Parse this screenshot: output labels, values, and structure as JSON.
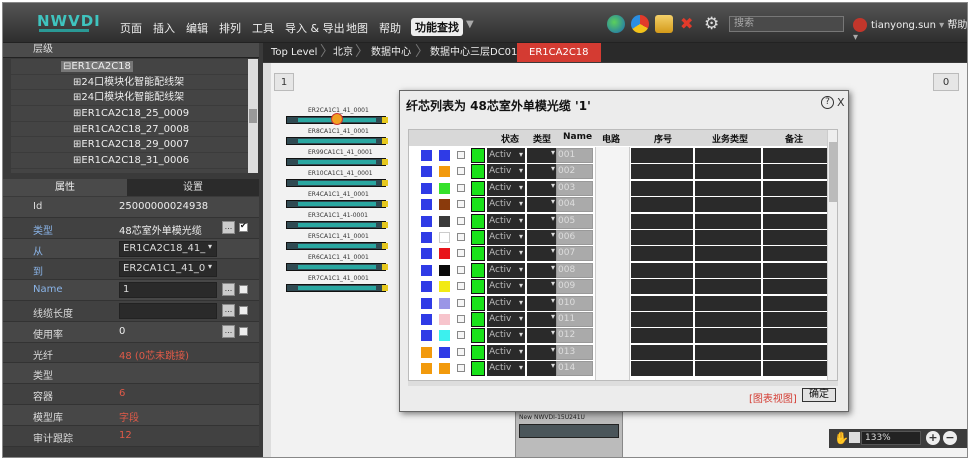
{
  "app": {
    "logo": "NWVDI"
  },
  "menu": [
    "页面",
    "插入",
    "编辑",
    "排列",
    "工具",
    "导入 & 导出",
    "地图",
    "帮助"
  ],
  "menu_search": "功能查找",
  "search_placeholder": "搜索",
  "user": {
    "name": "tianyong.sun",
    "help": "帮助"
  },
  "left": {
    "layer_title": "层级",
    "tree": [
      "⊟ER1CA2C18",
      "⊞24口模块化智能配线架",
      "⊞24口模块化智能配线架",
      "⊞ER1CA2C18_25_0009",
      "⊞ER1CA2C18_27_0008",
      "⊞ER1CA2C18_29_0007",
      "⊞ER1CA2C18_31_0006"
    ],
    "tabs": [
      "属性",
      "设置"
    ],
    "props": [
      {
        "label": "Id",
        "value": "25000000024938"
      },
      {
        "label": "类型",
        "value": "48芯室外单模光缆"
      },
      {
        "label": "从",
        "value": "ER1CA2C18_41_"
      },
      {
        "label": "到",
        "value": "ER2CA1C1_41_0"
      },
      {
        "label": "Name",
        "value": "1"
      },
      {
        "label": "线缆长度",
        "value": ""
      },
      {
        "label": "使用率",
        "value": "0"
      },
      {
        "label": "光纤",
        "value": "48 (0芯未跳接)"
      },
      {
        "label": "类型",
        "value": ""
      },
      {
        "label": "容器",
        "value": "6"
      },
      {
        "label": "模型库",
        "value": "字段"
      },
      {
        "label": "审计跟踪",
        "value": "12"
      }
    ]
  },
  "breadcrumb": [
    "Top Level",
    "北京",
    "数据中心",
    "数据中心三层DC01",
    "ER1CA2C18"
  ],
  "canvas": {
    "page_left": "1",
    "page_right": "0",
    "cables": [
      "ER2CA1C1_41_0001",
      "ER8CA1C1_41_0001",
      "ER99CA1C1_41_0001",
      "ER10CA1C1_41_0001",
      "ER4CA1C1_41_0001",
      "ER3CA1C1_41-0001",
      "ER5CA1C1_41_0001",
      "ER6CA1C1_41_0001",
      "ER7CA1C1_41_0001"
    ],
    "minimap_title": "New NWVDI-15U241U",
    "zoom": "133%"
  },
  "dialog": {
    "title": "纤芯列表为 48芯室外单模光缆 '1'",
    "help": "?",
    "close": "X",
    "headers": [
      "状态",
      "类型",
      "Name",
      "电路",
      "序号",
      "业务类型",
      "备注"
    ],
    "rows": [
      {
        "c1": "#2f3be6",
        "c2": "#2f3be6",
        "status": "Activ",
        "name": "001"
      },
      {
        "c1": "#2f3be6",
        "c2": "#f29a0c",
        "status": "Activ",
        "name": "002"
      },
      {
        "c1": "#2f3be6",
        "c2": "#35e12a",
        "status": "Activ",
        "name": "003"
      },
      {
        "c1": "#2f3be6",
        "c2": "#8a3a0c",
        "status": "Activ",
        "name": "004"
      },
      {
        "c1": "#2f3be6",
        "c2": "#3a3a3a",
        "status": "Activ",
        "name": "005"
      },
      {
        "c1": "#2f3be6",
        "c2": "#ffffff",
        "status": "Activ",
        "name": "006"
      },
      {
        "c1": "#2f3be6",
        "c2": "#e8141a",
        "status": "Activ",
        "name": "007"
      },
      {
        "c1": "#2f3be6",
        "c2": "#0a0a0a",
        "status": "Activ",
        "name": "008"
      },
      {
        "c1": "#2f3be6",
        "c2": "#f2ea14",
        "status": "Activ",
        "name": "009"
      },
      {
        "c1": "#2f3be6",
        "c2": "#9a96e6",
        "status": "Activ",
        "name": "010"
      },
      {
        "c1": "#2f3be6",
        "c2": "#f7c4cc",
        "status": "Activ",
        "name": "011"
      },
      {
        "c1": "#2f3be6",
        "c2": "#3cf0ee",
        "status": "Activ",
        "name": "012"
      },
      {
        "c1": "#f29a0c",
        "c2": "#2f3be6",
        "status": "Activ",
        "name": "013"
      },
      {
        "c1": "#f29a0c",
        "c2": "#f29a0c",
        "status": "Activ",
        "name": "014"
      }
    ],
    "chart_view": "[图表视图]",
    "ok": "确定"
  }
}
